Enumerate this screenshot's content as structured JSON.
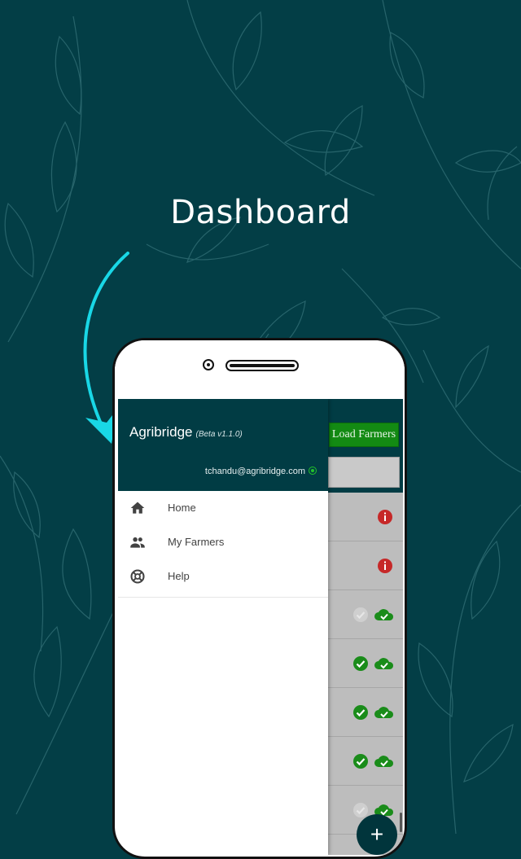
{
  "headline": "Dashboard",
  "app": {
    "load_button": "Load Farmers",
    "fab": "+"
  },
  "drawer": {
    "title": "Agribridge",
    "version": "(Beta v1.1.0)",
    "email": "tchandu@agribridge.com",
    "items": [
      {
        "label": "Home",
        "icon": "home-icon"
      },
      {
        "label": "My Farmers",
        "icon": "people-icon"
      },
      {
        "label": "Help",
        "icon": "help-lifebuoy-icon"
      }
    ]
  },
  "colors": {
    "background": "#033e46",
    "header": "#013c44",
    "accent_green": "#138a13",
    "error_red": "#d32f2f",
    "arrow": "#19d7e6"
  }
}
